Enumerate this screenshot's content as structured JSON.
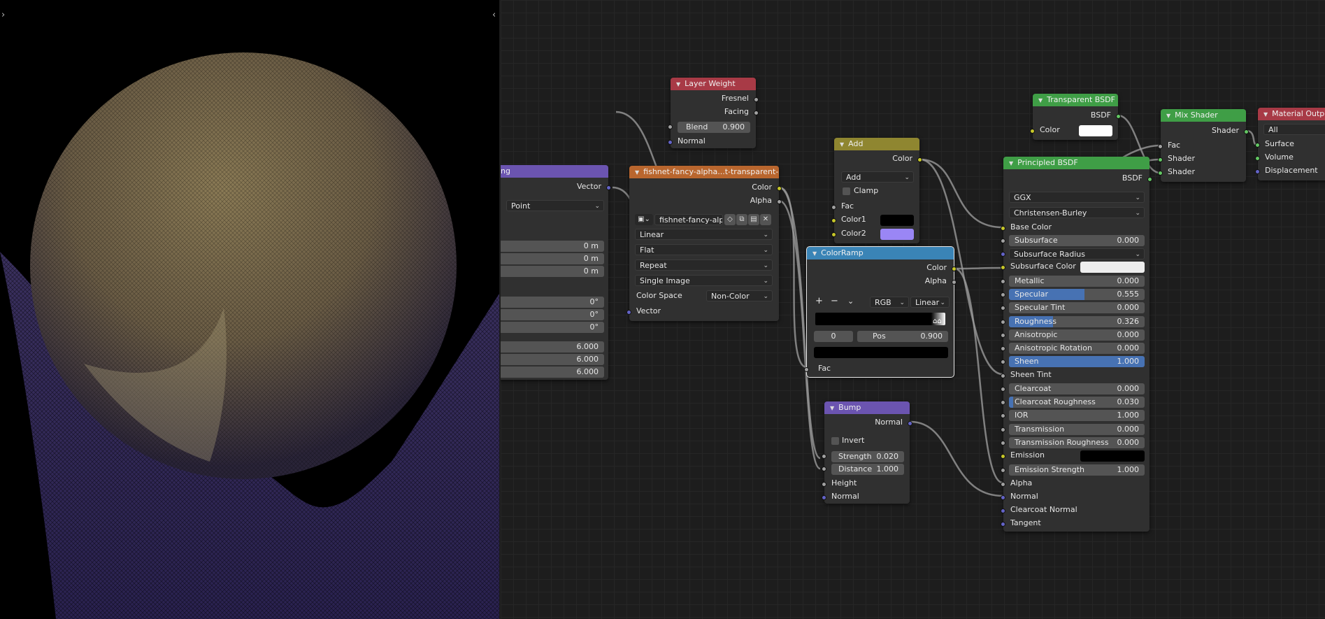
{
  "colors": {
    "layer_weight": "#a83a46",
    "add": "#8f8630",
    "image": "#b9662e",
    "mapping": "#6b54b0",
    "colorramp": "#3a84b6",
    "bump": "#6b54b0",
    "transparent": "#3f9e46",
    "mix": "#3f9e46",
    "principled": "#3f9e46",
    "output": "#a83a46"
  },
  "mapping": {
    "title": "ng",
    "vector": "Vector",
    "type": "Point",
    "loc": [
      "0 m",
      "0 m",
      "0 m"
    ],
    "rot": [
      "0°",
      "0°",
      "0°"
    ],
    "scale": [
      "6.000",
      "6.000",
      "6.000"
    ]
  },
  "image": {
    "title": "fishnet-fancy-alpha...t-transparent-seaml",
    "color": "Color",
    "alpha": "Alpha",
    "file": "fishnet-fancy-alp...",
    "interp": "Linear",
    "proj": "Flat",
    "ext": "Repeat",
    "src": "Single Image",
    "cs_label": "Color Space",
    "cs_value": "Non-Color",
    "vector": "Vector"
  },
  "layer_weight": {
    "title": "Layer Weight",
    "fresnel": "Fresnel",
    "facing": "Facing",
    "blend_label": "Blend",
    "blend_value": "0.900",
    "normal": "Normal"
  },
  "add": {
    "title": "Add",
    "color": "Color",
    "op": "Add",
    "clamp": "Clamp",
    "fac": "Fac",
    "color1": "Color1",
    "color2": "Color2",
    "color2_value": "#9a86f5",
    "color1_value": "#000000"
  },
  "colorramp": {
    "title": "ColorRamp",
    "color": "Color",
    "alpha": "Alpha",
    "plus": "+",
    "minus": "−",
    "mode": "RGB",
    "interp": "Linear",
    "index": "0",
    "pos_label": "Pos",
    "pos_value": "0.900",
    "fac": "Fac"
  },
  "bump": {
    "title": "Bump",
    "normal_out": "Normal",
    "invert": "Invert",
    "strength_label": "Strength",
    "strength_value": "0.020",
    "distance_label": "Distance",
    "distance_value": "1.000",
    "height": "Height",
    "normal_in": "Normal"
  },
  "transparent": {
    "title": "Transparent BSDF",
    "bsdf": "BSDF",
    "color": "Color"
  },
  "mix": {
    "title": "Mix Shader",
    "shader_out": "Shader",
    "fac": "Fac",
    "shader1": "Shader",
    "shader2": "Shader"
  },
  "output": {
    "title": "Material Outpu",
    "target": "All",
    "surface": "Surface",
    "volume": "Volume",
    "displacement": "Displacement"
  },
  "principled": {
    "title": "Principled BSDF",
    "bsdf": "BSDF",
    "distribution": "GGX",
    "sss": "Christensen-Burley",
    "base_color": "Base Color",
    "fields": [
      {
        "label": "Subsurface",
        "value": "0.000",
        "fill": 0
      },
      {
        "label": "Subsurface Radius",
        "value": "",
        "fill": 0,
        "dropdown": true
      },
      {
        "label": "Subsurface Color",
        "value": "",
        "fill": 0,
        "swatch": "#eeeeee"
      },
      {
        "label": "Metallic",
        "value": "0.000",
        "fill": 0
      },
      {
        "label": "Specular",
        "value": "0.555",
        "fill": 0.555
      },
      {
        "label": "Specular Tint",
        "value": "0.000",
        "fill": 0
      },
      {
        "label": "Roughness",
        "value": "0.326",
        "fill": 0.326
      },
      {
        "label": "Anisotropic",
        "value": "0.000",
        "fill": 0
      },
      {
        "label": "Anisotropic Rotation",
        "value": "0.000",
        "fill": 0
      },
      {
        "label": "Sheen",
        "value": "1.000",
        "fill": 1
      },
      {
        "label": "Sheen Tint",
        "value": "",
        "fill": 0,
        "plain": true
      },
      {
        "label": "Clearcoat",
        "value": "0.000",
        "fill": 0
      },
      {
        "label": "Clearcoat Roughness",
        "value": "0.030",
        "fill": 0.03
      },
      {
        "label": "IOR",
        "value": "1.000",
        "fill": 0
      },
      {
        "label": "Transmission",
        "value": "0.000",
        "fill": 0
      },
      {
        "label": "Transmission Roughness",
        "value": "0.000",
        "fill": 0
      },
      {
        "label": "Emission",
        "value": "",
        "fill": 0,
        "swatch": "#000000"
      },
      {
        "label": "Emission Strength",
        "value": "1.000",
        "fill": 0
      },
      {
        "label": "Alpha",
        "value": "",
        "fill": 0,
        "plain": true
      },
      {
        "label": "Normal",
        "value": "",
        "fill": 0,
        "plain": true
      },
      {
        "label": "Clearcoat Normal",
        "value": "",
        "fill": 0,
        "plain": true
      },
      {
        "label": "Tangent",
        "value": "",
        "fill": 0,
        "plain": true
      }
    ]
  }
}
